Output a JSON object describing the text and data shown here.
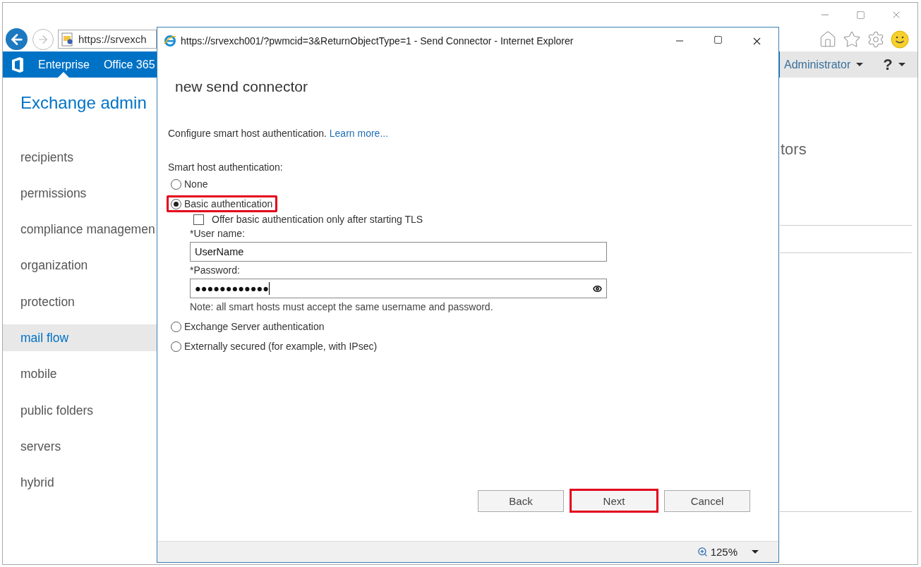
{
  "browser": {
    "address": "https://srvexch"
  },
  "header": {
    "nav": [
      {
        "label": "Enterprise",
        "selected": true
      },
      {
        "label": "Office 365",
        "selected": false
      }
    ],
    "user": "Administrator",
    "help": "?"
  },
  "page_title": "Exchange admin",
  "sidebar": {
    "items": [
      {
        "label": "recipients",
        "selected": false
      },
      {
        "label": "permissions",
        "selected": false
      },
      {
        "label": "compliance managemen",
        "selected": false
      },
      {
        "label": "organization",
        "selected": false
      },
      {
        "label": "protection",
        "selected": false
      },
      {
        "label": "mail flow",
        "selected": true
      },
      {
        "label": "mobile",
        "selected": false
      },
      {
        "label": "public folders",
        "selected": false
      },
      {
        "label": "servers",
        "selected": false
      },
      {
        "label": "hybrid",
        "selected": false
      }
    ]
  },
  "content": {
    "heading": "tors"
  },
  "dialog": {
    "title": "https://srvexch001/?pwmcid=3&ReturnObjectType=1 - Send Connector - Internet Explorer",
    "heading": "new send connector",
    "intro": "Configure smart host authentication.",
    "learn_more": "Learn more...",
    "group_label": "Smart host authentication:",
    "options": [
      {
        "label": "None",
        "selected": false,
        "highlighted": false
      },
      {
        "label": "Basic authentication",
        "selected": true,
        "highlighted": true,
        "details": {
          "checkbox": {
            "label": "Offer basic authentication only after starting TLS",
            "checked": false
          },
          "user_name": {
            "label": "*User name:",
            "value": "UserName"
          },
          "password": {
            "label": "*Password:",
            "value": "●●●●●●●●●●●●"
          },
          "note": "Note: all smart hosts must accept the same username and password."
        }
      },
      {
        "label": "Exchange Server authentication",
        "selected": false,
        "highlighted": false
      },
      {
        "label": "Externally secured (for example, with IPsec)",
        "selected": false,
        "highlighted": false
      }
    ],
    "buttons": [
      {
        "label": "Back",
        "highlighted": false
      },
      {
        "label": "Next",
        "highlighted": true
      },
      {
        "label": "Cancel",
        "highlighted": false
      }
    ],
    "zoom": "125%"
  }
}
